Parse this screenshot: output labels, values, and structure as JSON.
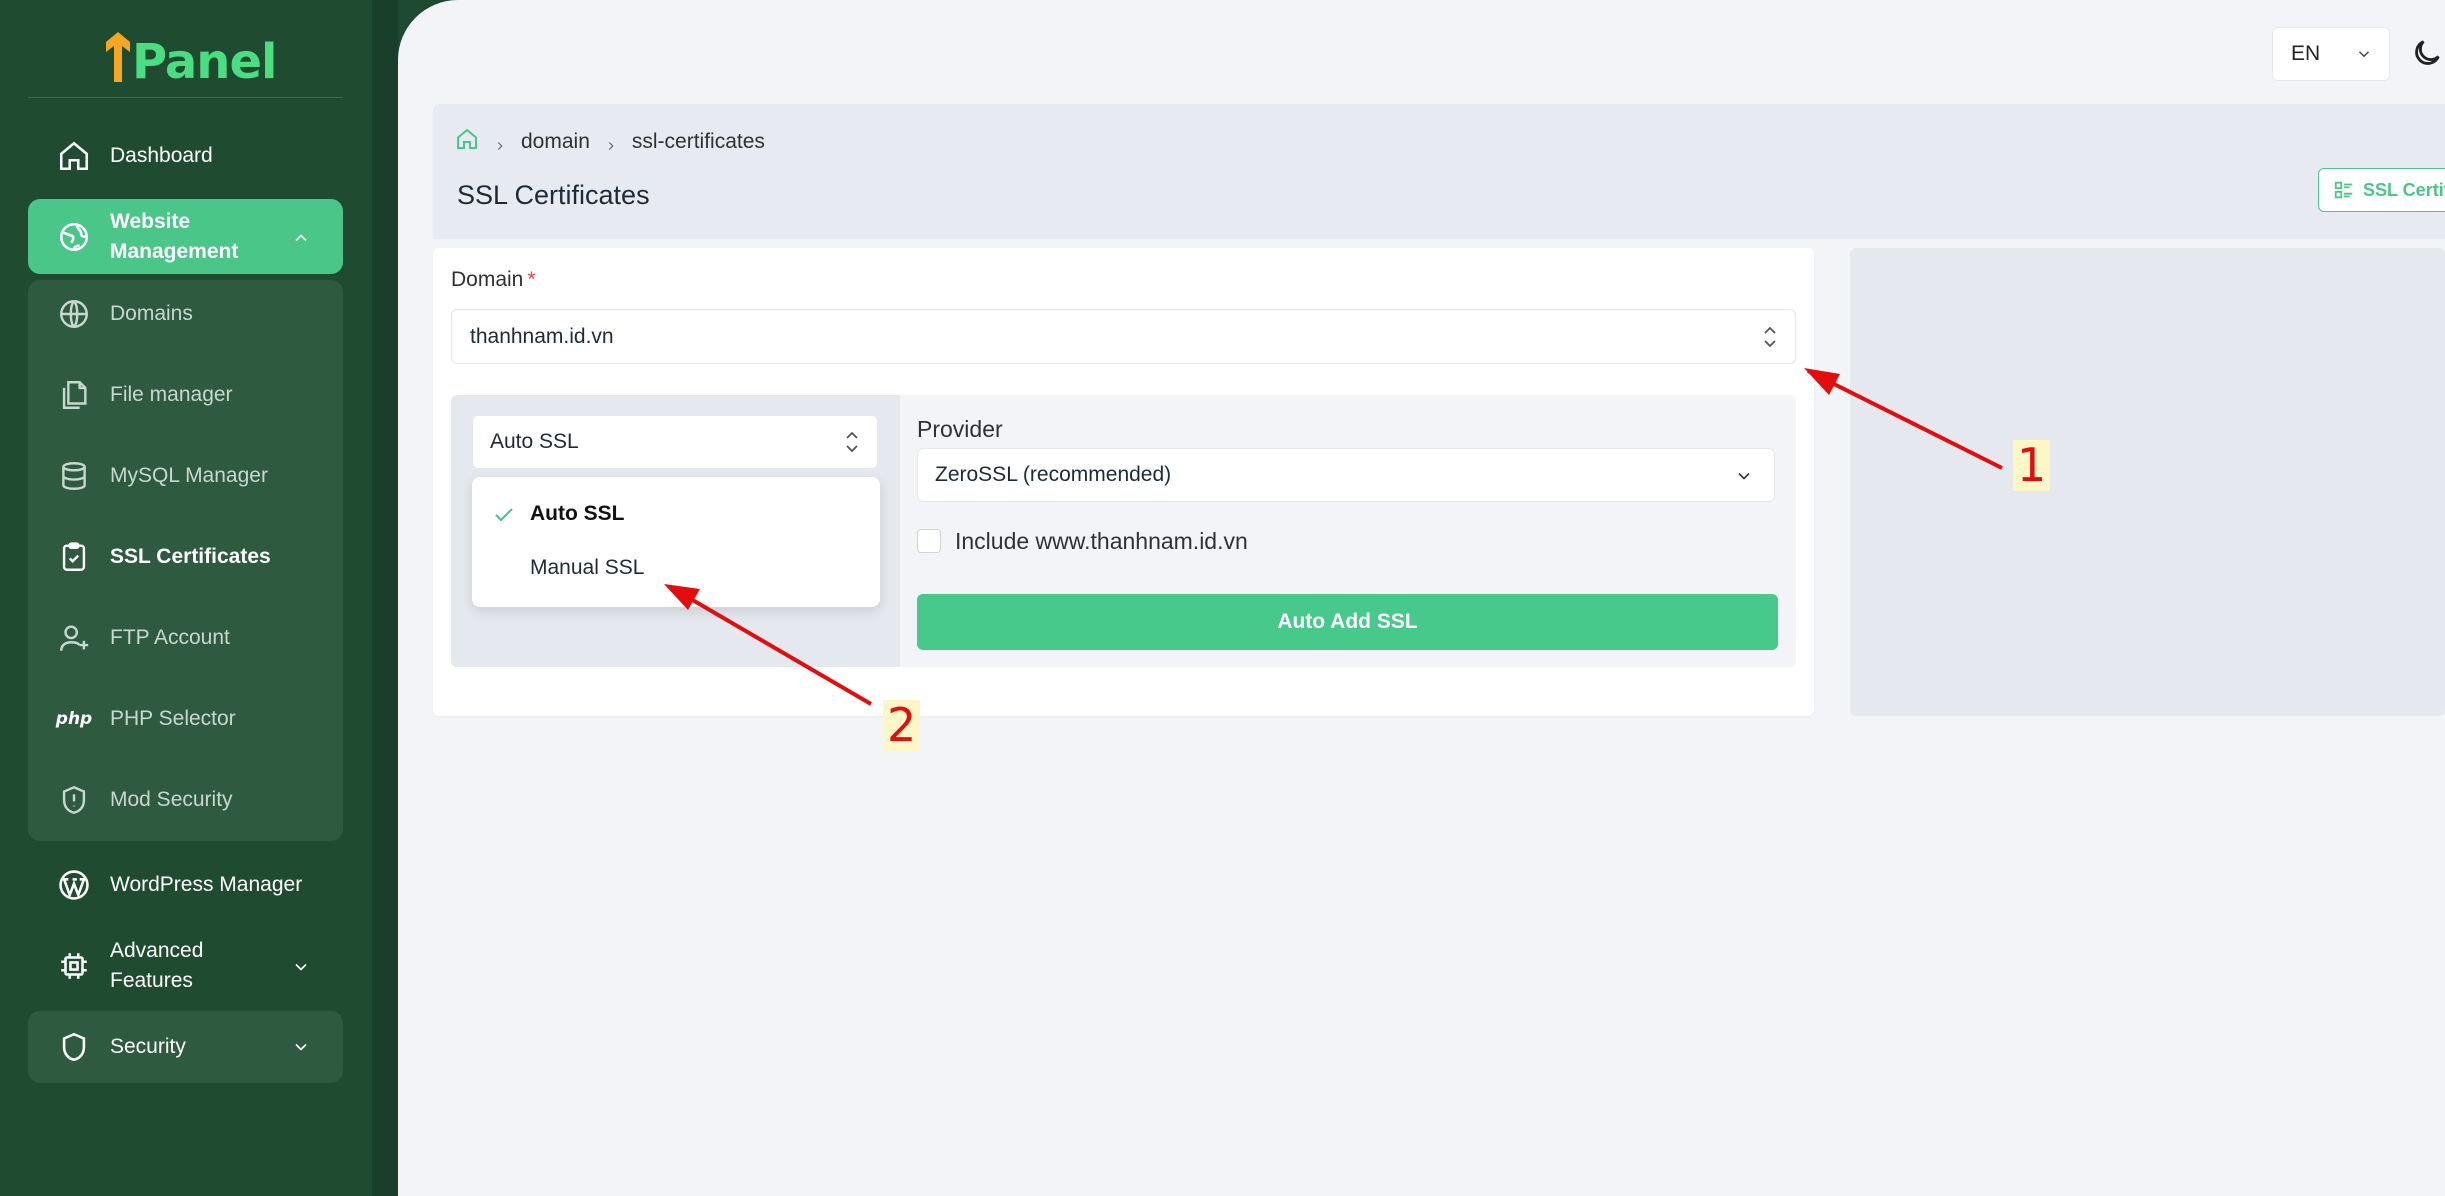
{
  "app": {
    "logo_text": "Panel",
    "logo_prefix": "1"
  },
  "sidebar": {
    "items": [
      {
        "id": "dashboard",
        "label": "Dashboard",
        "icon": "home-icon"
      },
      {
        "id": "website",
        "label": "Website Management",
        "icon": "globe-icon",
        "expanded": true
      },
      {
        "id": "wordpress",
        "label": "WordPress Manager",
        "icon": "wordpress-icon"
      },
      {
        "id": "advanced",
        "label": "Advanced Features",
        "icon": "cpu-icon"
      },
      {
        "id": "security",
        "label": "Security",
        "icon": "shield-icon"
      }
    ],
    "submenu": [
      {
        "label": "Domains",
        "icon": "globe-icon"
      },
      {
        "label": "File manager",
        "icon": "files-icon"
      },
      {
        "label": "MySQL Manager",
        "icon": "database-icon"
      },
      {
        "label": "SSL Certificates",
        "icon": "clipboard-check-icon",
        "active": true
      },
      {
        "label": "FTP Account",
        "icon": "user-plus-icon"
      },
      {
        "label": "PHP Selector",
        "icon": "php-icon",
        "icon_text": "php"
      },
      {
        "label": "Mod Security",
        "icon": "shield-alert-icon"
      }
    ]
  },
  "topbar": {
    "language": "EN"
  },
  "breadcrumb": [
    "domain",
    "ssl-certificates"
  ],
  "page": {
    "title": "SSL Certificates",
    "header_button": "SSL Certifi"
  },
  "form": {
    "domain_label": "Domain",
    "required_mark": "*",
    "domain_value": "thanhnam.id.vn",
    "ssl_type_value": "Auto SSL",
    "ssl_type_options": [
      {
        "label": "Auto SSL",
        "selected": true
      },
      {
        "label": "Manual SSL",
        "selected": false
      }
    ],
    "provider_label": "Provider",
    "provider_value": "ZeroSSL (recommended)",
    "include_www_label": "Include www.thanhnam.id.vn",
    "include_www_checked": false,
    "submit_label": "Auto Add SSL"
  },
  "annotations": {
    "marker_1": "1",
    "marker_2": "2"
  },
  "colors": {
    "sidebar_bg": "#1f4b31",
    "accent": "#4ac788",
    "button": "#47c98c",
    "annotation": "#e30d0d"
  }
}
